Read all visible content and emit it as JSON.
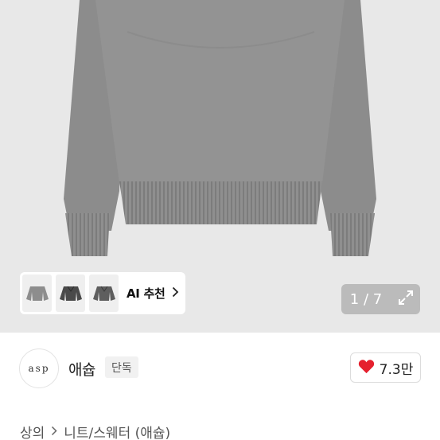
{
  "ai_recommend": {
    "label": "AI 추천",
    "chevron": "chevron-right-icon",
    "thumbnails": [
      "sweater-thumb-1",
      "sweater-thumb-2",
      "sweater-thumb-3"
    ]
  },
  "gallery": {
    "pager_text": "1 / 7",
    "expand_icon": "expand-icon"
  },
  "shop": {
    "logo_text": "asp",
    "name": "애슙",
    "badge": "단독"
  },
  "like": {
    "icon": "heart-icon",
    "count": "7.3만",
    "color": "#e5202e"
  },
  "breadcrumb": {
    "category": "상의",
    "subcategory": "니트/스웨터 (애슙)"
  }
}
